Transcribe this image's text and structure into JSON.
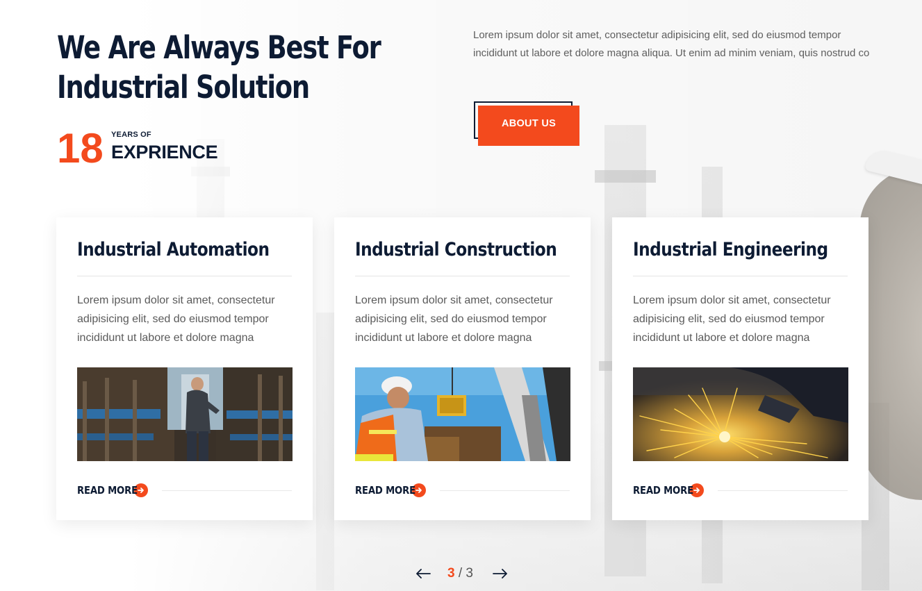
{
  "hero": {
    "title_line1": "We Are Always Best For",
    "title_line2": "Industrial Solution",
    "experience_number": "18",
    "experience_small": "YEARS OF",
    "experience_big": "EXPRIENCE",
    "intro": "Lorem ipsum dolor sit amet, consectetur adipisicing elit, sed do eiusmod tempor incididunt ut labore et dolore magna aliqua. Ut enim ad minim veniam, quis nostrud co",
    "about_label": "ABOUT US"
  },
  "cards": [
    {
      "title": "Industrial Automation",
      "text": "Lorem ipsum dolor sit amet, consectetur adipisicing elit, sed do eiusmod tempor incididunt ut labore et dolore magna",
      "read_more": "READ MORE",
      "image": "factory-worker-machinery"
    },
    {
      "title": "Industrial Construction",
      "text": "Lorem ipsum dolor sit amet, consectetur adipisicing elit, sed do eiusmod tempor incididunt ut labore et dolore magna",
      "read_more": "READ MORE",
      "image": "construction-worker-crane"
    },
    {
      "title": "Industrial Engineering",
      "text": "Lorem ipsum dolor sit amet, consectetur adipisicing elit, sed do eiusmod tempor incididunt ut labore et dolore magna",
      "read_more": "READ MORE",
      "image": "welding-sparks"
    }
  ],
  "pager": {
    "current": "3",
    "separator": " / ",
    "total": "3",
    "prev_icon": "arrow-left-icon",
    "next_icon": "arrow-right-icon"
  },
  "colors": {
    "accent": "#f34a1d",
    "navy": "#0d1b33",
    "body_text": "#5a5a5a"
  }
}
